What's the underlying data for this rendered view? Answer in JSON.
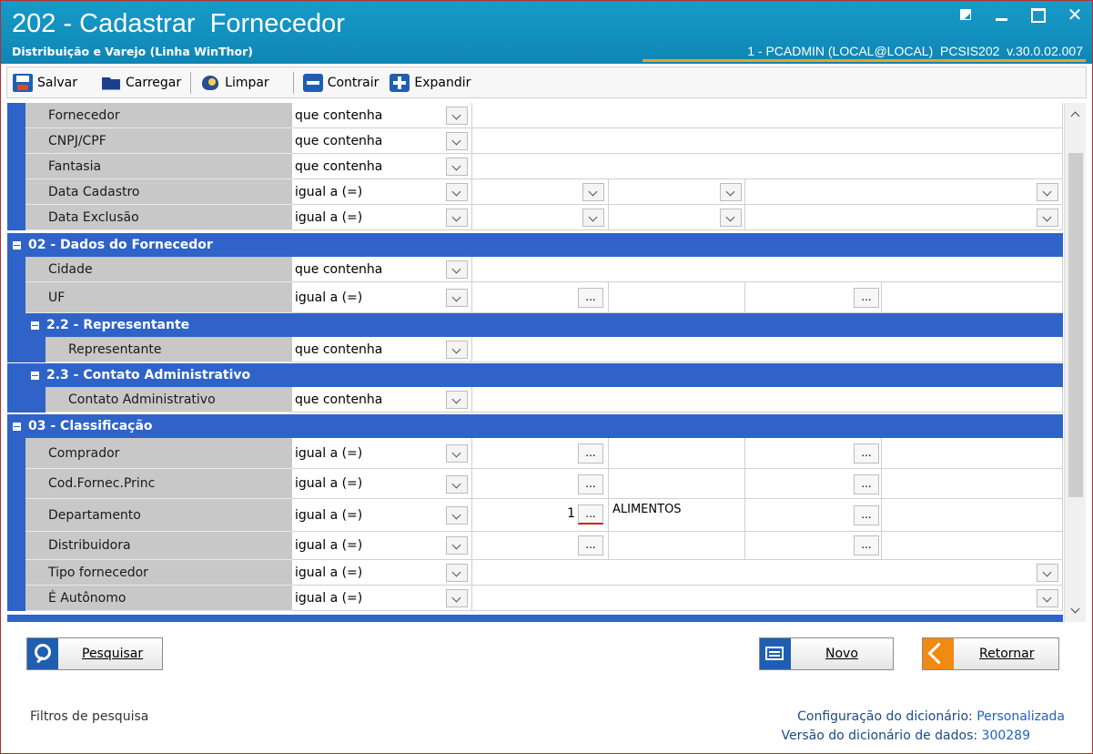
{
  "window": {
    "title": "202 - Cadastrar  Fornecedor",
    "subtitle": "Distribuição e Varejo (Linha WinThor)",
    "userinfo": "1 - PCADMIN (LOCAL@LOCAL)  PCSIS202  v.30.0.02.007",
    "controls": {
      "restore": "restore-icon",
      "minimize": "minimize-icon",
      "maximize": "maximize-icon",
      "close": "✕"
    }
  },
  "toolbar": {
    "save": "Salvar",
    "load": "Carregar",
    "clear": "Limpar",
    "collapse": "Contrair",
    "expand": "Expandir"
  },
  "filters": {
    "fornecedor": {
      "label": "Fornecedor",
      "op": "que contenha"
    },
    "cnpj": {
      "label": "CNPJ/CPF",
      "op": "que contenha"
    },
    "fantasia": {
      "label": "Fantasia",
      "op": "que contenha"
    },
    "data_cadastro": {
      "label": "Data Cadastro",
      "op": "igual a (=)"
    },
    "data_exclusao": {
      "label": "Data Exclusão",
      "op": "igual a (=)"
    },
    "group02": "02 - Dados do Fornecedor",
    "cidade": {
      "label": "Cidade",
      "op": "que contenha"
    },
    "uf": {
      "label": "UF",
      "op": "igual a (=)"
    },
    "group22": "2.2 - Representante",
    "representante": {
      "label": "Representante",
      "op": "que contenha"
    },
    "group23": "2.3 - Contato Administrativo",
    "contato": {
      "label": "Contato Administrativo",
      "op": "que contenha"
    },
    "group03": "03 - Classificação",
    "comprador": {
      "label": "Comprador",
      "op": "igual a (=)"
    },
    "codfornec": {
      "label": "Cod.Fornec.Princ",
      "op": "igual a (=)"
    },
    "departamento": {
      "label": "Departamento",
      "op": "igual a (=)",
      "code": "1",
      "desc": "ALIMENTOS"
    },
    "distribuidora": {
      "label": "Distribuidora",
      "op": "igual a (=)"
    },
    "tipo": {
      "label": "Tipo fornecedor",
      "op": "igual a (=)"
    },
    "autonomo": {
      "label": "É Autônomo",
      "op": "igual a (=)"
    },
    "ellipsis": "..."
  },
  "buttons": {
    "search": "Pesquisar",
    "new": "Novo",
    "back": "Retornar"
  },
  "status": {
    "left": "Filtros de pesquisa",
    "config_label": "Configuração do dicionário:",
    "config_value": "Personalizada",
    "version_label": "Versão do dicionário de dados:",
    "version_value": "300289"
  },
  "colors": {
    "titlebar": "#169bc8",
    "group_header": "#2f63c8",
    "label_cell": "#c8c8c8",
    "accent_orange": "#f0a020"
  }
}
